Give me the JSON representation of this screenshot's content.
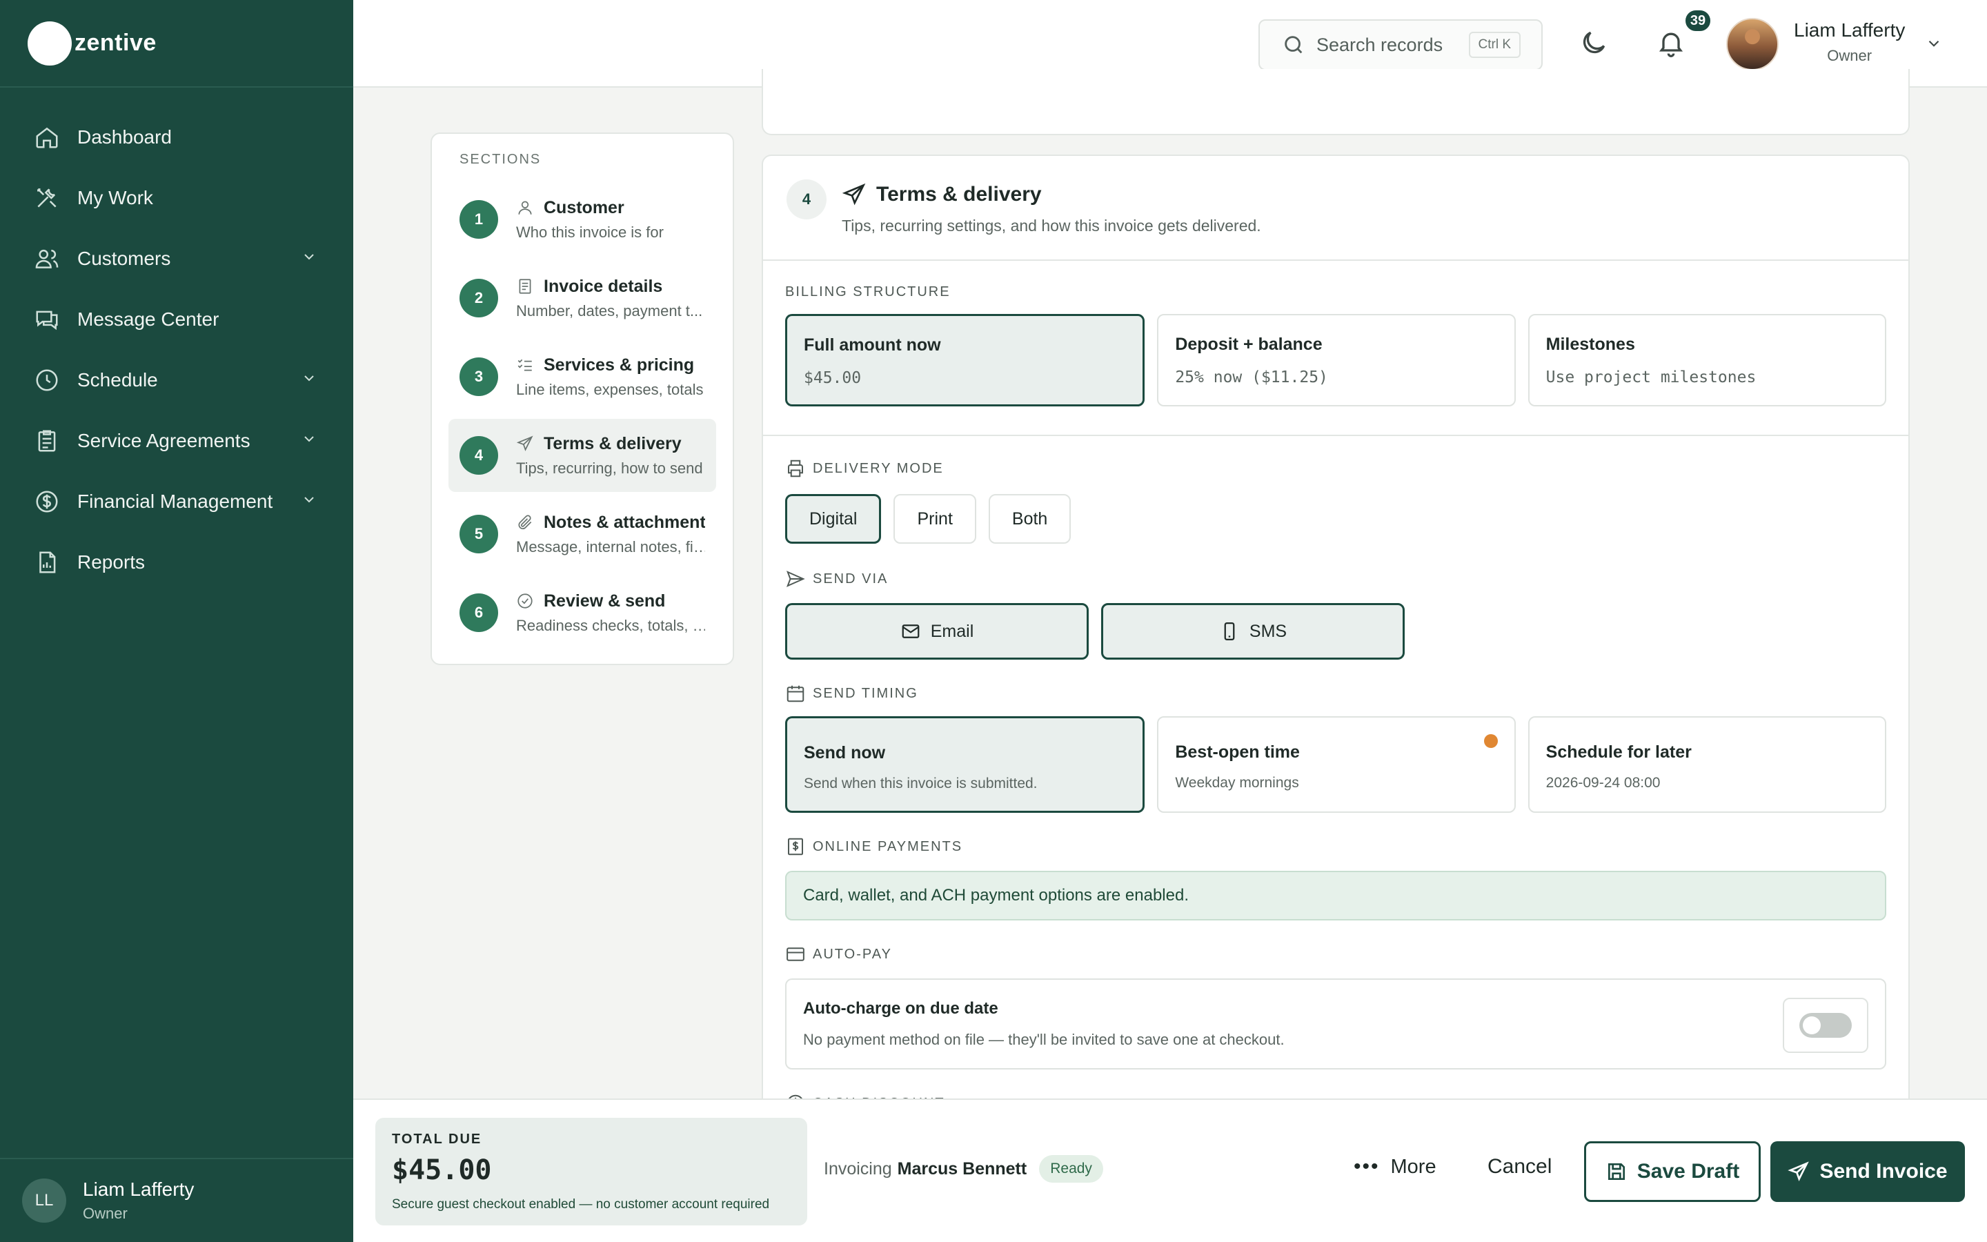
{
  "app": {
    "brand": "zentive"
  },
  "sidebar": {
    "items": [
      {
        "label": "Dashboard",
        "icon": "home-icon"
      },
      {
        "label": "My Work",
        "icon": "tools-icon"
      },
      {
        "label": "Customers",
        "icon": "users-icon",
        "expandable": true
      },
      {
        "label": "Message Center",
        "icon": "message-icon"
      },
      {
        "label": "Schedule",
        "icon": "clock-icon",
        "expandable": true
      },
      {
        "label": "Service Agreements",
        "icon": "clipboard-icon",
        "expandable": true
      },
      {
        "label": "Financial Management",
        "icon": "dollar-icon",
        "expandable": true
      },
      {
        "label": "Reports",
        "icon": "report-icon"
      }
    ],
    "user": {
      "initials": "LL",
      "name": "Liam Lafferty",
      "role": "Owner"
    }
  },
  "header": {
    "search_placeholder": "Search records",
    "search_shortcut": "Ctrl K",
    "notification_count": "39",
    "user_name": "Liam Lafferty",
    "user_role": "Owner"
  },
  "sections": {
    "title": "SECTIONS",
    "items": [
      {
        "num": "1",
        "title": "Customer",
        "sub": "Who this invoice is for",
        "icon": "person-icon"
      },
      {
        "num": "2",
        "title": "Invoice details",
        "sub": "Number, dates, payment t...",
        "icon": "document-icon"
      },
      {
        "num": "3",
        "title": "Services & pricing",
        "sub": "Line items, expenses, totals",
        "icon": "checklist-icon"
      },
      {
        "num": "4",
        "title": "Terms & delivery",
        "sub": "Tips, recurring, how to send",
        "icon": "send-icon",
        "active": true
      },
      {
        "num": "5",
        "title": "Notes & attachments",
        "sub": "Message, internal notes, files",
        "icon": "paperclip-icon"
      },
      {
        "num": "6",
        "title": "Review & send",
        "sub": "Readiness checks, totals, s...",
        "icon": "check-circle-icon"
      }
    ]
  },
  "card": {
    "step": "4",
    "title": "Terms & delivery",
    "subtitle": "Tips, recurring settings, and how this invoice gets delivered.",
    "billing": {
      "label": "BILLING STRUCTURE",
      "options": [
        {
          "title": "Full amount now",
          "sub": "$45.00",
          "selected": true
        },
        {
          "title": "Deposit + balance",
          "sub": "25% now ($11.25)"
        },
        {
          "title": "Milestones",
          "sub": "Use project milestones"
        }
      ]
    },
    "delivery": {
      "label": "DELIVERY MODE",
      "options": [
        "Digital",
        "Print",
        "Both"
      ],
      "selected": "Digital"
    },
    "send_via": {
      "label": "SEND VIA",
      "email": "Email",
      "sms": "SMS"
    },
    "timing": {
      "label": "SEND TIMING",
      "options": [
        {
          "title": "Send now",
          "sub": "Send when this invoice is submitted.",
          "selected": true
        },
        {
          "title": "Best-open time",
          "sub": "Weekday mornings",
          "dot": true
        },
        {
          "title": "Schedule for later",
          "sub": "2026-09-24 08:00"
        }
      ]
    },
    "online_payments": {
      "label": "ONLINE PAYMENTS",
      "notice": "Card, wallet, and ACH payment options are enabled."
    },
    "auto_pay": {
      "label": "AUTO-PAY",
      "title": "Auto-charge on due date",
      "sub": "No payment method on file — they'll be invited to save one at checkout.",
      "enabled": false
    },
    "cash_discount": {
      "label": "CASH DISCOUNT"
    }
  },
  "footer": {
    "total_label": "TOTAL DUE",
    "total_value": "$45.00",
    "total_note": "Secure guest checkout enabled — no customer account required",
    "invoicing_prefix": "Invoicing",
    "customer": "Marcus Bennett",
    "status": "Ready",
    "more": "More",
    "cancel": "Cancel",
    "save": "Save Draft",
    "send": "Send Invoice"
  },
  "colors": {
    "brand": "#1b4a3f",
    "step": "#2f7a5c",
    "accent_dot": "#e08732"
  }
}
